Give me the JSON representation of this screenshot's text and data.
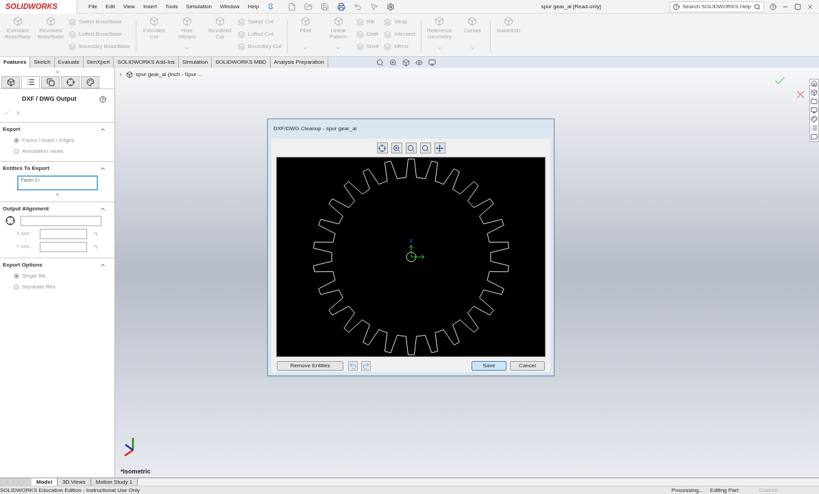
{
  "app": {
    "logo": "SOLIDWORKS"
  },
  "menu": [
    "File",
    "Edit",
    "View",
    "Insert",
    "Tools",
    "Simulation",
    "Window",
    "Help"
  ],
  "document_title": "spur gear_ai [Read-only]",
  "search": {
    "placeholder": "Search SOLIDWORKS Help"
  },
  "ribbon": [
    {
      "kind": "large",
      "label": "Extruded\nBoss/Base",
      "menu": false
    },
    {
      "kind": "large",
      "label": "Revolved\nBoss/Base",
      "menu": false
    },
    {
      "kind": "stack",
      "items": [
        "Swept Boss/Base",
        "Lofted Boss/Base",
        "Boundary Boss/Base"
      ]
    },
    {
      "kind": "separator"
    },
    {
      "kind": "large",
      "label": "Extruded\nCut",
      "menu": false
    },
    {
      "kind": "large",
      "label": "Hole\nWizard",
      "menu": true
    },
    {
      "kind": "large",
      "label": "Revolved\nCut",
      "menu": false
    },
    {
      "kind": "stack",
      "items": [
        "Swept Cut",
        "Lofted Cut",
        "Boundary Cut"
      ]
    },
    {
      "kind": "separator"
    },
    {
      "kind": "large",
      "label": "Fillet",
      "menu": true
    },
    {
      "kind": "large",
      "label": "Linear\nPattern",
      "menu": true
    },
    {
      "kind": "stack",
      "items": [
        "Rib",
        "Draft",
        "Shell"
      ]
    },
    {
      "kind": "stack",
      "items": [
        "Wrap",
        "Intersect",
        "Mirror"
      ]
    },
    {
      "kind": "separator"
    },
    {
      "kind": "large",
      "label": "Reference\nGeometry",
      "menu": true
    },
    {
      "kind": "large",
      "label": "Curves",
      "menu": true
    },
    {
      "kind": "separator"
    },
    {
      "kind": "large",
      "label": "Instant3D",
      "menu": false
    }
  ],
  "command_tabs": [
    {
      "label": "Features",
      "selected": true
    },
    {
      "label": "Sketch",
      "selected": false
    },
    {
      "label": "Evaluate",
      "selected": false
    },
    {
      "label": "DimXpert",
      "selected": false
    },
    {
      "label": "SOLIDWORKS Add-Ins",
      "selected": false
    },
    {
      "label": "Simulation",
      "selected": false
    },
    {
      "label": "SOLIDWORKS MBD",
      "selected": false
    },
    {
      "label": "Analysis Preparation",
      "selected": false
    }
  ],
  "tree": {
    "root": "spur gear_ai  (Inch - Spur ..."
  },
  "property_manager": {
    "tabs": [
      {
        "kind": "feature",
        "selected": false
      },
      {
        "kind": "property",
        "selected": true
      },
      {
        "kind": "configuration",
        "selected": false
      },
      {
        "kind": "dimxpert",
        "selected": false
      },
      {
        "kind": "display",
        "selected": false
      }
    ],
    "title": "DXF / DWG Output",
    "sections": [
      {
        "title": "Export",
        "kind": "radios",
        "options": [
          {
            "label": "Faces / loops / edges",
            "selected": true
          },
          {
            "label": "Annotation views",
            "selected": false
          }
        ]
      },
      {
        "title": "Entities To Export",
        "kind": "list",
        "items": [
          "Face<1>"
        ]
      },
      {
        "title": "Output Alignment",
        "kind": "alignment",
        "fields": [
          {
            "label": "X axis :"
          },
          {
            "label": "Y axis :"
          }
        ]
      },
      {
        "title": "Export Options",
        "kind": "radios",
        "options": [
          {
            "label": "Single file",
            "selected": true
          },
          {
            "label": "Separate files",
            "selected": false
          }
        ]
      }
    ]
  },
  "dialog": {
    "title": "DXF/DWG Cleanup - spur gear_ai",
    "buttons": [
      {
        "label": "Remove Entities",
        "default": false
      },
      {
        "label": "Save",
        "default": true
      },
      {
        "label": "Cancel",
        "default": false
      }
    ]
  },
  "view_label": "*Isometric",
  "bottom_tabs": [
    {
      "label": "Model",
      "selected": true
    },
    {
      "label": "3D Views",
      "selected": false
    },
    {
      "label": "Motion Study 1",
      "selected": false
    }
  ],
  "status_bar": {
    "left": "SOLIDWORKS Education Edition - Instructional Use Only",
    "items": [
      {
        "text": "Processing...",
        "disabled": false
      },
      {
        "text": "Editing Part",
        "disabled": false
      },
      {
        "text": "Custom",
        "disabled": true
      }
    ]
  }
}
